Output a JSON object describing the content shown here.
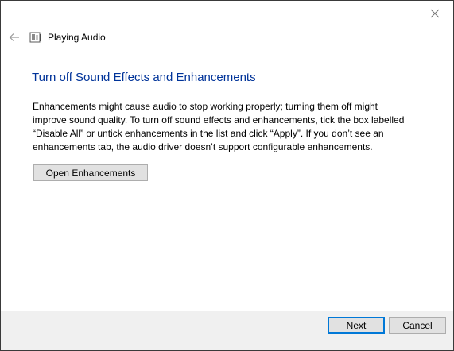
{
  "window": {
    "title": "Playing Audio"
  },
  "icons": {
    "close": "close-icon",
    "back": "back-arrow-icon",
    "header": "speaker-troubleshoot-icon"
  },
  "main": {
    "heading": "Turn off Sound Effects and Enhancements",
    "description_lines": [
      "Enhancements might cause audio to stop working properly; turning them off might",
      "improve sound quality. To turn off sound effects and enhancements, tick the box labelled",
      "“Disable All” or untick enhancements in the list and click “Apply”. If you don’t see an",
      "enhancements tab, the audio driver doesn’t support configurable enhancements."
    ],
    "open_button_label": "Open Enhancements"
  },
  "footer": {
    "next_label": "Next",
    "cancel_label": "Cancel"
  },
  "colors": {
    "heading": "#003399",
    "footer_bg": "#f0f0f0",
    "button_bg": "#e1e1e1",
    "focus_border": "#0078d7"
  }
}
